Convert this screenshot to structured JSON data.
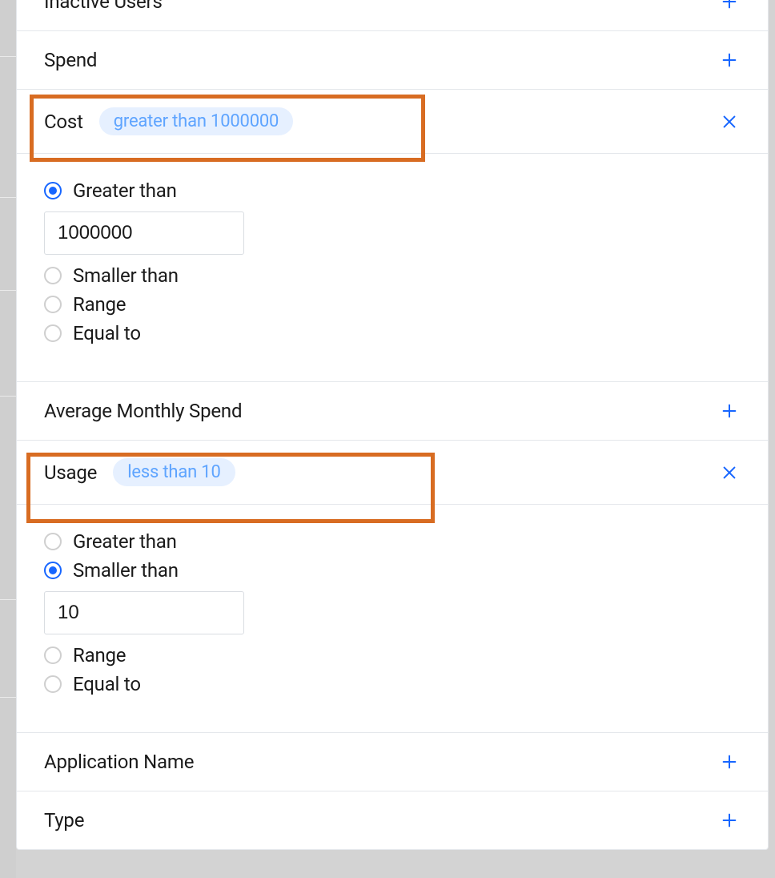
{
  "colors": {
    "accent_blue": "#1766ff",
    "chip_bg": "#e6f0ff",
    "chip_text": "#5ea4ff",
    "highlight_orange": "#d86c22"
  },
  "filters": {
    "inactive_users": {
      "label": "Inactive Users"
    },
    "spend": {
      "label": "Spend"
    },
    "cost": {
      "label": "Cost",
      "chip": "greater than 1000000",
      "options": {
        "greater_than": "Greater than",
        "smaller_than": "Smaller than",
        "range": "Range",
        "equal_to": "Equal to"
      },
      "selected": "greater_than",
      "value": "1000000"
    },
    "avg_monthly_spend": {
      "label": "Average Monthly Spend"
    },
    "usage": {
      "label": "Usage",
      "chip": "less than 10",
      "options": {
        "greater_than": "Greater than",
        "smaller_than": "Smaller than",
        "range": "Range",
        "equal_to": "Equal to"
      },
      "selected": "smaller_than",
      "value": "10"
    },
    "application_name": {
      "label": "Application Name"
    },
    "type": {
      "label": "Type"
    }
  }
}
